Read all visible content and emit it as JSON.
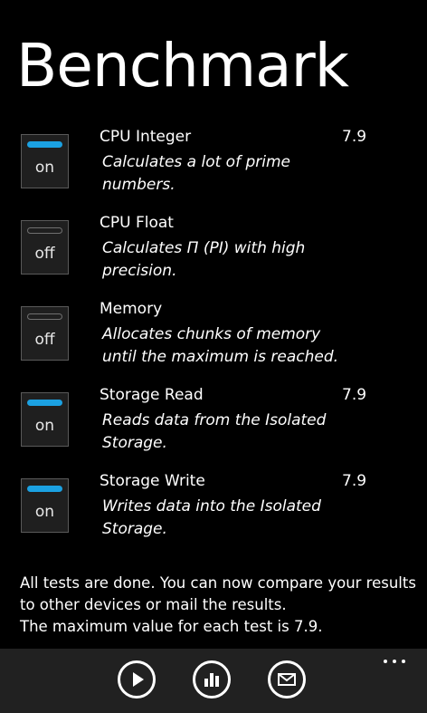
{
  "page": {
    "title": "Benchmark"
  },
  "tests": [
    {
      "name": "CPU Integer",
      "description": "Calculates a lot of prime numbers.",
      "toggle": "on",
      "score": "7.9"
    },
    {
      "name": "CPU Float",
      "description": "Calculates Π (PI) with high precision.",
      "toggle": "off",
      "score": ""
    },
    {
      "name": "Memory",
      "description": "Allocates chunks of memory until the maximum is reached.",
      "toggle": "off",
      "score": ""
    },
    {
      "name": "Storage Read",
      "description": "Reads data from the Isolated Storage.",
      "toggle": "on",
      "score": "7.9"
    },
    {
      "name": "Storage Write",
      "description": "Writes data into the Isolated Storage.",
      "toggle": "on",
      "score": "7.9"
    }
  ],
  "summary": {
    "line1": "All tests are done. You can now compare your results to other devices or mail the results.",
    "line2": "The maximum value for each test is 7.9."
  },
  "app_bar": {
    "buttons": [
      {
        "icon": "play-icon"
      },
      {
        "icon": "bar-chart-icon"
      },
      {
        "icon": "mail-icon"
      }
    ],
    "more": "more-icon"
  },
  "colors": {
    "background": "#000000",
    "accent": "#1ba1e2",
    "app_bar": "#212121"
  }
}
